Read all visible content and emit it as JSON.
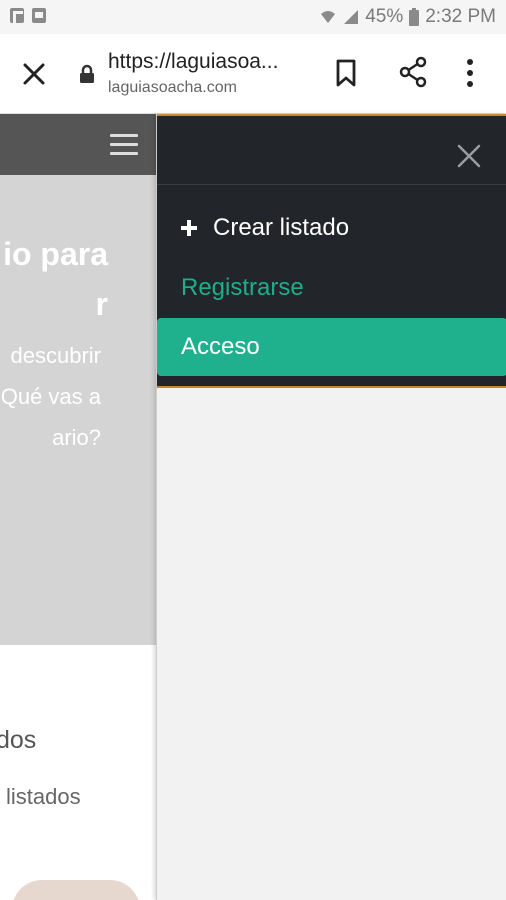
{
  "status_bar": {
    "battery": "45%",
    "time": "2:32 PM"
  },
  "browser": {
    "url": "https://laguiasoa...",
    "domain": "laguiasoacha.com"
  },
  "background_page": {
    "hero_title_line1": "io para",
    "hero_title_line2": "r",
    "hero_text_line1": "descubrir",
    "hero_text_line2": "Qué vas a",
    "hero_text_line3": "ario?",
    "section_text1": "dos",
    "section_text2": "listados"
  },
  "drawer": {
    "create_listing": "Crear listado",
    "register": "Registrarse",
    "login": "Acceso"
  },
  "colors": {
    "accent": "#1fb08d",
    "drawer_bg": "#222529",
    "drawer_border": "#c28a2c"
  }
}
